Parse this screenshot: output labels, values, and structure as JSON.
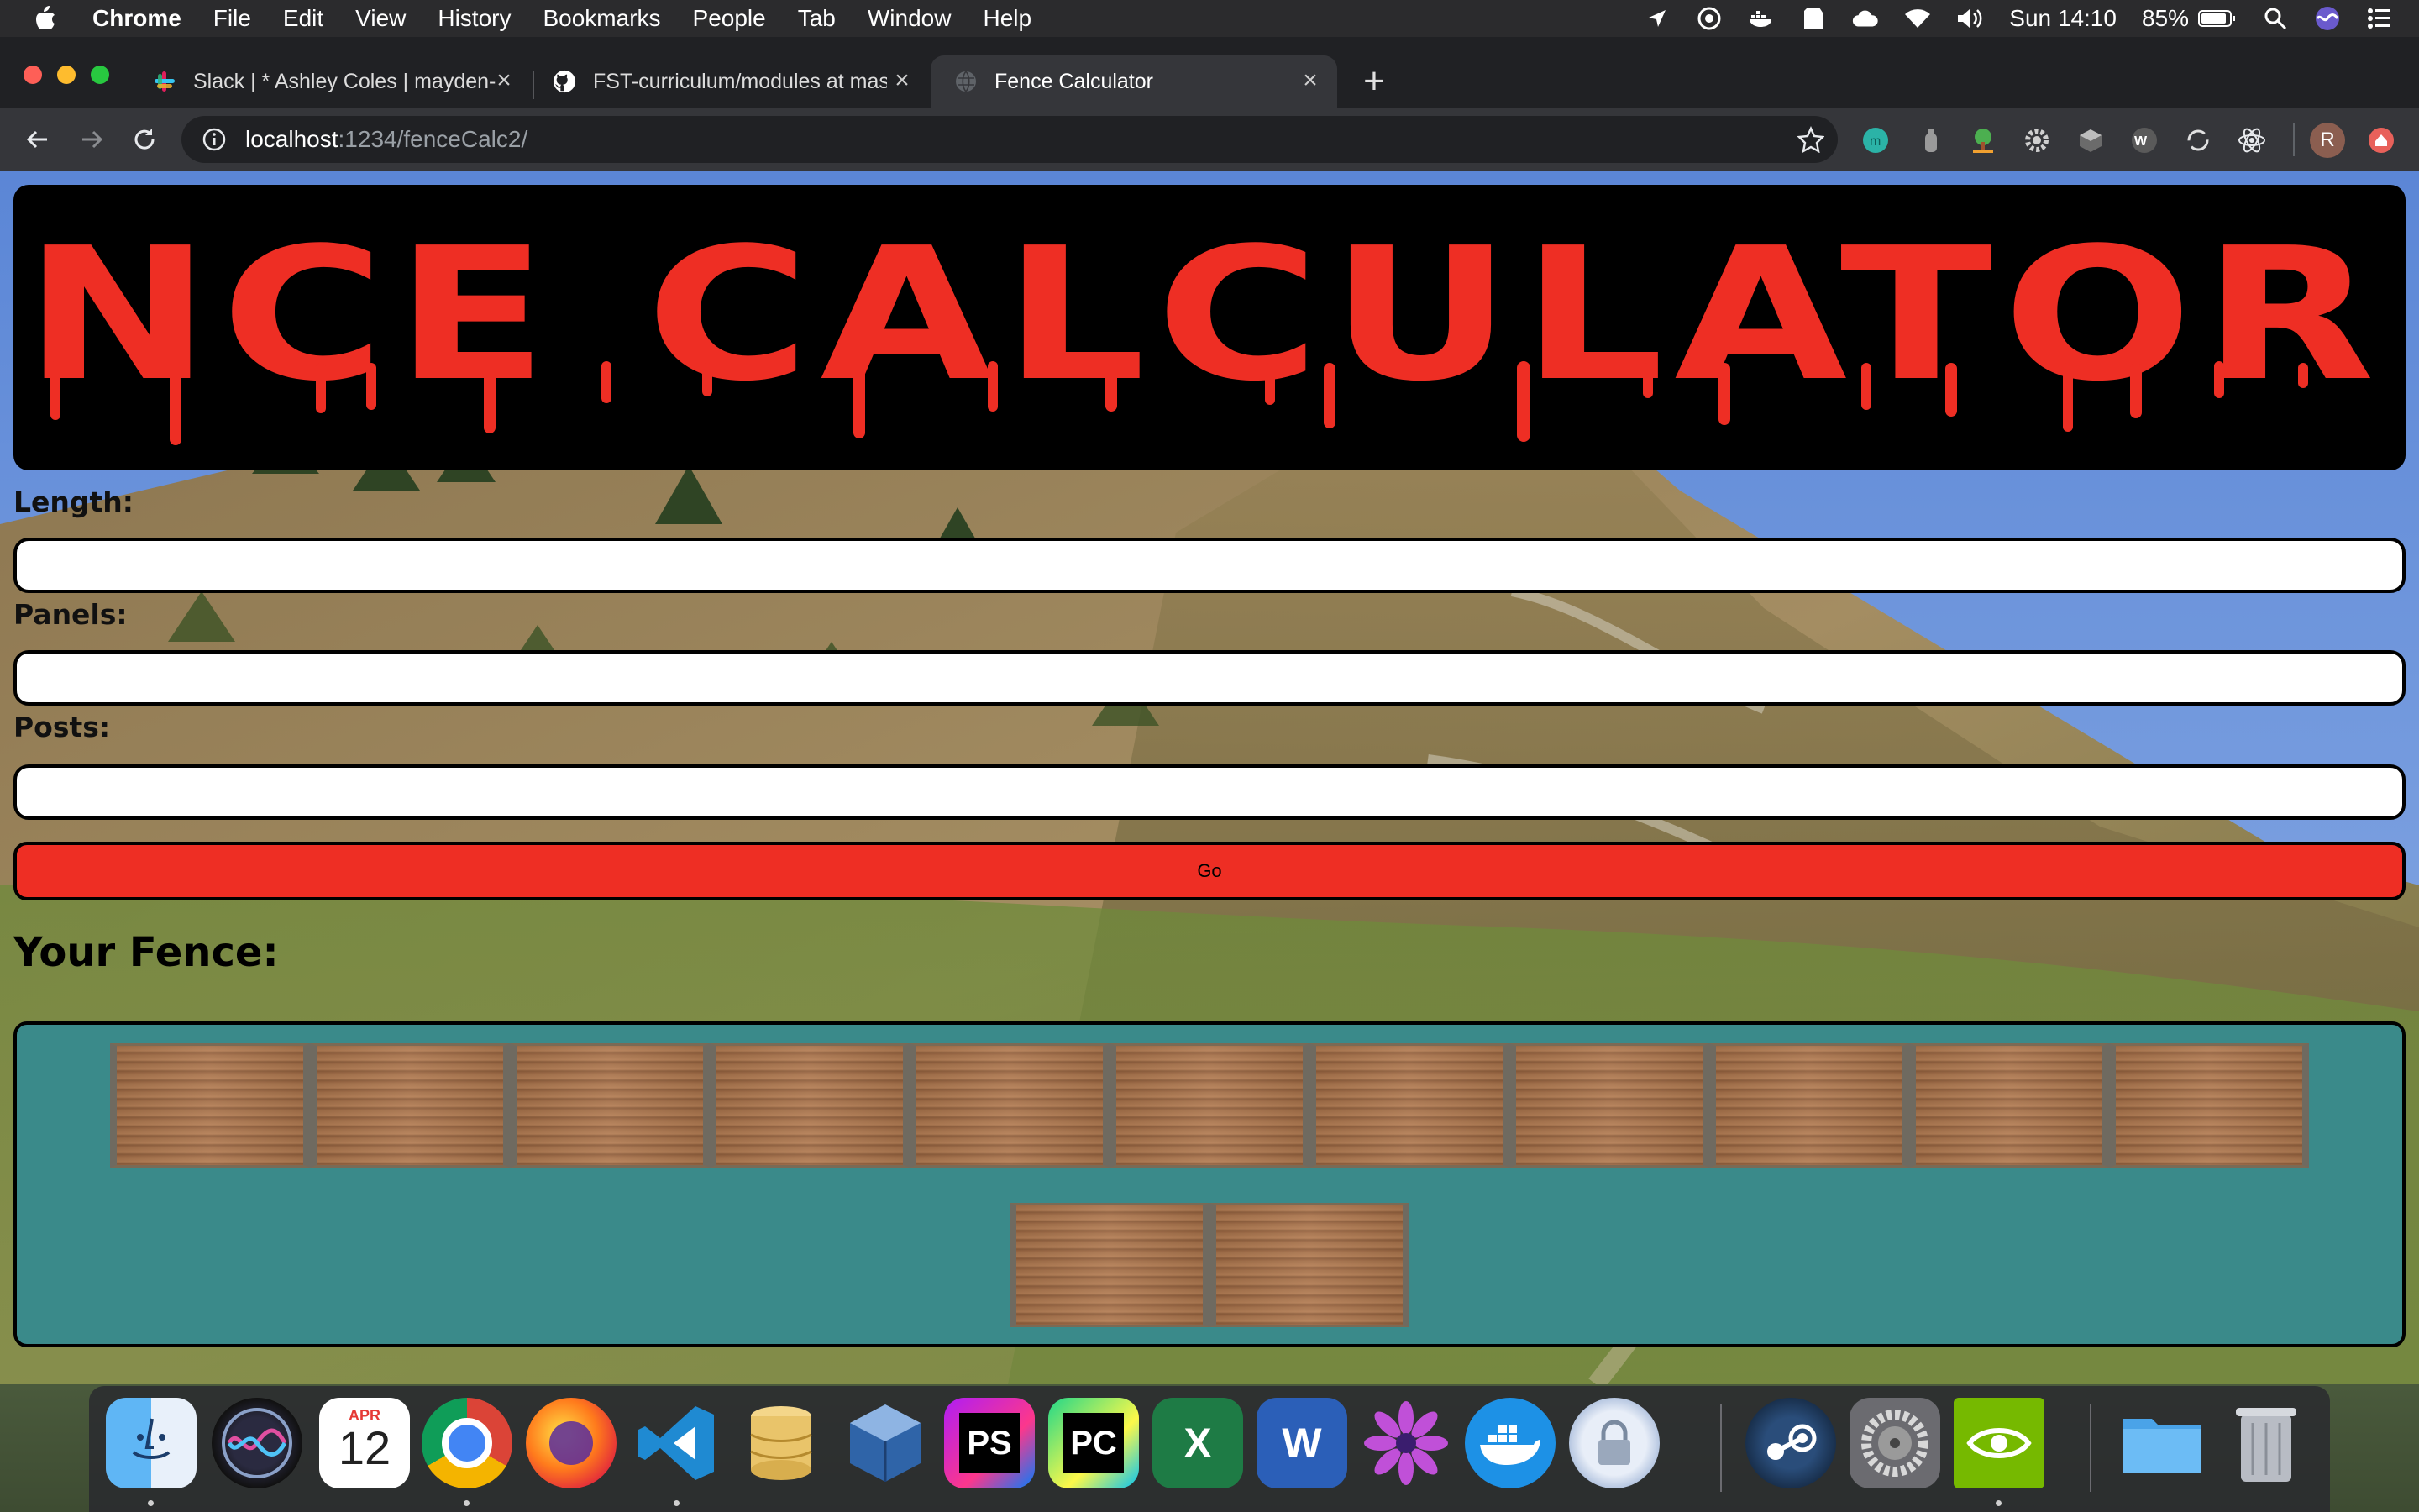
{
  "menubar": {
    "app_name": "Chrome",
    "items": [
      "File",
      "Edit",
      "View",
      "History",
      "Bookmarks",
      "People",
      "Tab",
      "Window",
      "Help"
    ],
    "clock": "Sun 14:10",
    "battery": "85%"
  },
  "tabs": [
    {
      "title": "Slack | * Ashley Coles | mayden-",
      "icon": "slack-icon"
    },
    {
      "title": "FST-curriculum/modules at mast",
      "icon": "github-icon"
    },
    {
      "title": "Fence Calculator",
      "icon": "globe-icon",
      "active": true
    }
  ],
  "address_bar": {
    "host": "localhost",
    "rest": ":1234/fenceCalc2/"
  },
  "profile_initial": "R",
  "page": {
    "banner_title": "FENCE CALCULATOR!!!",
    "length_label": "Length:",
    "panels_label": "Panels:",
    "posts_label": "Posts:",
    "length_value": "",
    "panels_value": "",
    "posts_value": "",
    "go_label": "Go",
    "fence_heading": "Your Fence:",
    "fence_rows": [
      11,
      2
    ]
  },
  "colors": {
    "accent_red": "#ee2e24",
    "fence_box": "#3a8a8a"
  },
  "dock": {
    "calendar_month": "APR",
    "calendar_day": "12",
    "apps": [
      "Finder",
      "Siri",
      "Calendar",
      "Chrome",
      "Firefox",
      "VS Code",
      "Sequel Pro",
      "VirtualBox",
      "PhpStorm",
      "PyCharm",
      "Excel",
      "Word",
      "Flower",
      "Docker",
      "Keychain",
      "Steam",
      "System Preferences",
      "NVIDIA",
      "Folder",
      "Trash"
    ]
  }
}
